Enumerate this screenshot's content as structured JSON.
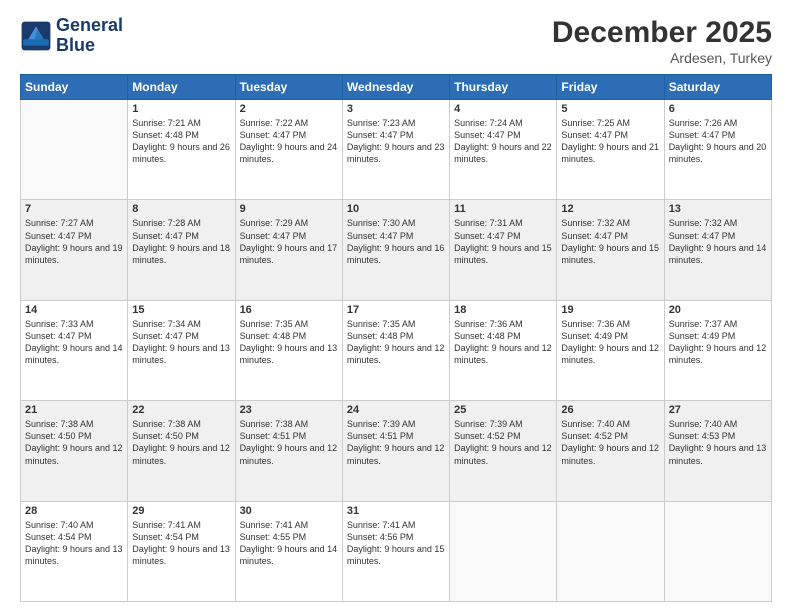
{
  "logo": {
    "line1": "General",
    "line2": "Blue"
  },
  "title": "December 2025",
  "subtitle": "Ardesen, Turkey",
  "days_of_week": [
    "Sunday",
    "Monday",
    "Tuesday",
    "Wednesday",
    "Thursday",
    "Friday",
    "Saturday"
  ],
  "weeks": [
    [
      {
        "day": "",
        "empty": true
      },
      {
        "day": "1",
        "sunrise": "7:21 AM",
        "sunset": "4:48 PM",
        "daylight": "9 hours and 26 minutes."
      },
      {
        "day": "2",
        "sunrise": "7:22 AM",
        "sunset": "4:47 PM",
        "daylight": "9 hours and 24 minutes."
      },
      {
        "day": "3",
        "sunrise": "7:23 AM",
        "sunset": "4:47 PM",
        "daylight": "9 hours and 23 minutes."
      },
      {
        "day": "4",
        "sunrise": "7:24 AM",
        "sunset": "4:47 PM",
        "daylight": "9 hours and 22 minutes."
      },
      {
        "day": "5",
        "sunrise": "7:25 AM",
        "sunset": "4:47 PM",
        "daylight": "9 hours and 21 minutes."
      },
      {
        "day": "6",
        "sunrise": "7:26 AM",
        "sunset": "4:47 PM",
        "daylight": "9 hours and 20 minutes."
      }
    ],
    [
      {
        "day": "7",
        "sunrise": "7:27 AM",
        "sunset": "4:47 PM",
        "daylight": "9 hours and 19 minutes."
      },
      {
        "day": "8",
        "sunrise": "7:28 AM",
        "sunset": "4:47 PM",
        "daylight": "9 hours and 18 minutes."
      },
      {
        "day": "9",
        "sunrise": "7:29 AM",
        "sunset": "4:47 PM",
        "daylight": "9 hours and 17 minutes."
      },
      {
        "day": "10",
        "sunrise": "7:30 AM",
        "sunset": "4:47 PM",
        "daylight": "9 hours and 16 minutes."
      },
      {
        "day": "11",
        "sunrise": "7:31 AM",
        "sunset": "4:47 PM",
        "daylight": "9 hours and 15 minutes."
      },
      {
        "day": "12",
        "sunrise": "7:32 AM",
        "sunset": "4:47 PM",
        "daylight": "9 hours and 15 minutes."
      },
      {
        "day": "13",
        "sunrise": "7:32 AM",
        "sunset": "4:47 PM",
        "daylight": "9 hours and 14 minutes."
      }
    ],
    [
      {
        "day": "14",
        "sunrise": "7:33 AM",
        "sunset": "4:47 PM",
        "daylight": "9 hours and 14 minutes."
      },
      {
        "day": "15",
        "sunrise": "7:34 AM",
        "sunset": "4:47 PM",
        "daylight": "9 hours and 13 minutes."
      },
      {
        "day": "16",
        "sunrise": "7:35 AM",
        "sunset": "4:48 PM",
        "daylight": "9 hours and 13 minutes."
      },
      {
        "day": "17",
        "sunrise": "7:35 AM",
        "sunset": "4:48 PM",
        "daylight": "9 hours and 12 minutes."
      },
      {
        "day": "18",
        "sunrise": "7:36 AM",
        "sunset": "4:48 PM",
        "daylight": "9 hours and 12 minutes."
      },
      {
        "day": "19",
        "sunrise": "7:36 AM",
        "sunset": "4:49 PM",
        "daylight": "9 hours and 12 minutes."
      },
      {
        "day": "20",
        "sunrise": "7:37 AM",
        "sunset": "4:49 PM",
        "daylight": "9 hours and 12 minutes."
      }
    ],
    [
      {
        "day": "21",
        "sunrise": "7:38 AM",
        "sunset": "4:50 PM",
        "daylight": "9 hours and 12 minutes."
      },
      {
        "day": "22",
        "sunrise": "7:38 AM",
        "sunset": "4:50 PM",
        "daylight": "9 hours and 12 minutes."
      },
      {
        "day": "23",
        "sunrise": "7:38 AM",
        "sunset": "4:51 PM",
        "daylight": "9 hours and 12 minutes."
      },
      {
        "day": "24",
        "sunrise": "7:39 AM",
        "sunset": "4:51 PM",
        "daylight": "9 hours and 12 minutes."
      },
      {
        "day": "25",
        "sunrise": "7:39 AM",
        "sunset": "4:52 PM",
        "daylight": "9 hours and 12 minutes."
      },
      {
        "day": "26",
        "sunrise": "7:40 AM",
        "sunset": "4:52 PM",
        "daylight": "9 hours and 12 minutes."
      },
      {
        "day": "27",
        "sunrise": "7:40 AM",
        "sunset": "4:53 PM",
        "daylight": "9 hours and 13 minutes."
      }
    ],
    [
      {
        "day": "28",
        "sunrise": "7:40 AM",
        "sunset": "4:54 PM",
        "daylight": "9 hours and 13 minutes."
      },
      {
        "day": "29",
        "sunrise": "7:41 AM",
        "sunset": "4:54 PM",
        "daylight": "9 hours and 13 minutes."
      },
      {
        "day": "30",
        "sunrise": "7:41 AM",
        "sunset": "4:55 PM",
        "daylight": "9 hours and 14 minutes."
      },
      {
        "day": "31",
        "sunrise": "7:41 AM",
        "sunset": "4:56 PM",
        "daylight": "9 hours and 15 minutes."
      },
      {
        "day": "",
        "empty": true
      },
      {
        "day": "",
        "empty": true
      },
      {
        "day": "",
        "empty": true
      }
    ]
  ]
}
